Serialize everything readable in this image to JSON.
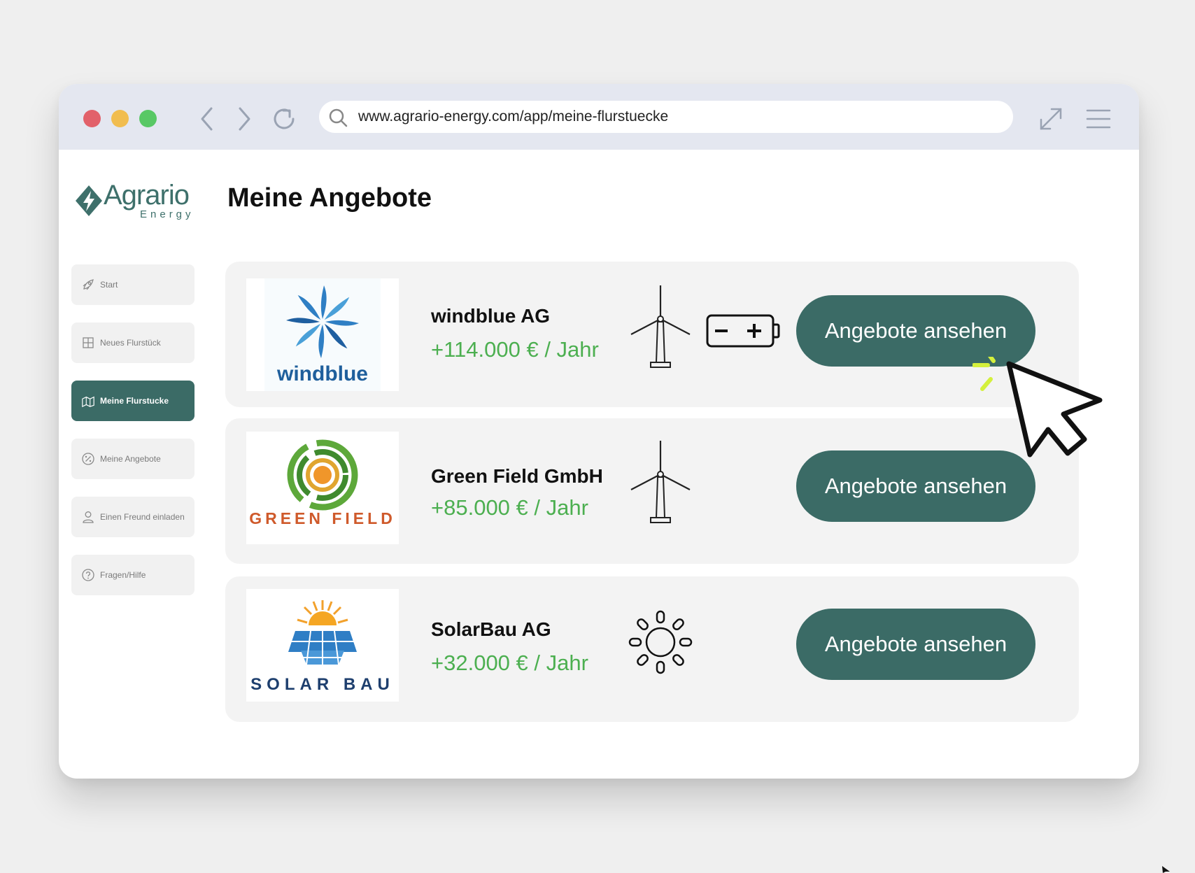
{
  "browser": {
    "url": "www.agrario-energy.com/app/meine-flurstuecke",
    "icons": [
      "back-icon",
      "forward-icon",
      "reload-icon",
      "search-icon",
      "expand-icon",
      "menu-icon"
    ],
    "traffic_lights": [
      "#e2616a",
      "#f1bd4f",
      "#58c865"
    ]
  },
  "logo": {
    "name": "Agrario",
    "sub": "Energy"
  },
  "page": {
    "title": "Meine Angebote"
  },
  "sidebar": {
    "items": [
      {
        "label": "Start",
        "icon": "rocket-icon",
        "active": false
      },
      {
        "label": "Neues Flurstück",
        "icon": "grid-icon",
        "active": false
      },
      {
        "label": "Meine Flurstucke",
        "icon": "map-icon",
        "active": true
      },
      {
        "label": "Meine Angebote",
        "icon": "percent-icon",
        "active": false
      },
      {
        "label": "Einen Freund einladen",
        "icon": "user-icon",
        "active": false
      },
      {
        "label": "Fragen/Hilfe",
        "icon": "help-icon",
        "active": false
      }
    ]
  },
  "offers": [
    {
      "logo_text": "windblue",
      "company": "windblue AG",
      "amount": "+114.000 € / Jahr",
      "button": "Angebote ansehen",
      "icons": [
        "wind-turbine-icon",
        "battery-icon"
      ]
    },
    {
      "logo_text": "GREEN FIELD",
      "company": "Green Field GmbH",
      "amount": "+85.000 € / Jahr",
      "button": "Angebote ansehen",
      "icons": [
        "wind-turbine-icon"
      ]
    },
    {
      "logo_text": "SOLAR BAU",
      "company": "SolarBau AG",
      "amount": "+32.000 € / Jahr",
      "button": "Angebote ansehen",
      "icons": [
        "sun-icon"
      ]
    }
  ],
  "colors": {
    "accent": "#3b6b66",
    "amount": "#4caf50",
    "brand": "#3e706b",
    "click_highlight": "#d4f03c"
  }
}
